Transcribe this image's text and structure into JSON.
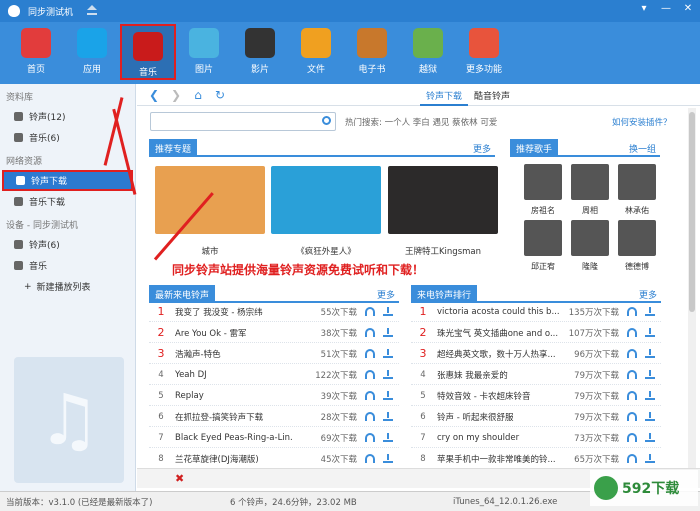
{
  "window": {
    "title": "同步测试机",
    "controls": [
      "▾",
      "—",
      "✕"
    ]
  },
  "toolbar": [
    {
      "label": "首页",
      "color": "#e23c3c"
    },
    {
      "label": "应用",
      "color": "#1aa3e8"
    },
    {
      "label": "音乐",
      "color": "#c91b1b",
      "active": true
    },
    {
      "label": "图片",
      "color": "#4ab3e0"
    },
    {
      "label": "影片",
      "color": "#333333"
    },
    {
      "label": "文件",
      "color": "#f0a020"
    },
    {
      "label": "电子书",
      "color": "#c8782c"
    },
    {
      "label": "越狱",
      "color": "#6ab04c"
    },
    {
      "label": "更多功能",
      "color": "#e8543c"
    }
  ],
  "sidebar": {
    "sections": [
      {
        "title": "资料库",
        "items": [
          "铃声(12)",
          "音乐(6)"
        ]
      },
      {
        "title": "网络资源",
        "items": [
          "铃声下载",
          "音乐下载"
        ]
      },
      {
        "title": "设备 - 同步测试机",
        "items": [
          "铃声(6)",
          "音乐"
        ]
      }
    ],
    "add_playlist": "新建播放列表",
    "art_icon": "music-note-icon"
  },
  "nav": {
    "tabs": [
      "铃声下载",
      "酷音铃声"
    ]
  },
  "search": {
    "placeholder": "",
    "hot_label": "热门搜索: 一个人 李白 遇见 蔡依林 可爱",
    "install_link": "如何安装插件？"
  },
  "featured": {
    "title": "推荐专题",
    "more": "更多",
    "cards": [
      {
        "caption": "城市",
        "color": "#e8a050"
      },
      {
        "caption": "《疯狂外星人》",
        "color": "#2aa0d8"
      },
      {
        "caption": "王牌特工Kingsman",
        "color": "#2c2a2a"
      }
    ]
  },
  "singers": {
    "title": "推荐歌手",
    "more": "换一组",
    "names": [
      "房祖名",
      "周相",
      "林承佑",
      "邱正宥",
      "隆隆",
      "德德博"
    ]
  },
  "promo": "同步铃声站提供海量铃声资源免费试听和下载！",
  "latest": {
    "title": "最新来电铃声",
    "more": "更多",
    "rows": [
      {
        "num": "1",
        "name": "我变了 我没变 - 杨宗纬",
        "count": "55次下载"
      },
      {
        "num": "2",
        "name": "Are You Ok - 雷军",
        "count": "38次下载"
      },
      {
        "num": "3",
        "name": "浩瀚声-特色",
        "count": "51次下载"
      },
      {
        "num": "4",
        "name": "Yeah DJ",
        "count": "122次下载"
      },
      {
        "num": "5",
        "name": "Replay",
        "count": "39次下载"
      },
      {
        "num": "6",
        "name": "在抓拉登-搞笑铃声下载",
        "count": "28次下载"
      },
      {
        "num": "7",
        "name": "Black Eyed Peas-Ring-a-Lin...",
        "count": "69次下载"
      },
      {
        "num": "8",
        "name": "兰花草旋律(DJ海潮版)",
        "count": "45次下载"
      }
    ]
  },
  "ranking": {
    "title": "来电铃声排行",
    "more": "更多",
    "rows": [
      {
        "num": "1",
        "name": "victoria acosta could this b...",
        "count": "135万次下载"
      },
      {
        "num": "2",
        "name": "珠光宝气 英文插曲one and o...",
        "count": "107万次下载"
      },
      {
        "num": "3",
        "name": "超经典英文歌，数十万人热享...",
        "count": "96万次下载"
      },
      {
        "num": "4",
        "name": "张惠妹 我最亲爱的",
        "count": "79万次下载"
      },
      {
        "num": "5",
        "name": "特效音效 - 卡农超床铃音",
        "count": "79万次下载"
      },
      {
        "num": "6",
        "name": "铃声 - 听起来很舒服",
        "count": "79万次下载"
      },
      {
        "num": "7",
        "name": "cry on my shoulder",
        "count": "73万次下载"
      },
      {
        "num": "8",
        "name": "苹果手机中一款非常唯美的铃...",
        "count": "65万次下载"
      }
    ]
  },
  "status": {
    "version": "当前版本：v3.1.0    (已经是最新版本了)",
    "stats": "6 个铃声，24.6分钟，23.02 MB",
    "file": "iTunes_64_12.0.1.26.exe"
  },
  "watermark": "592下载",
  "colors": {
    "accent": "#3a8ddb",
    "highlight": "#e02020",
    "titlebar": "#2b7fd0"
  }
}
